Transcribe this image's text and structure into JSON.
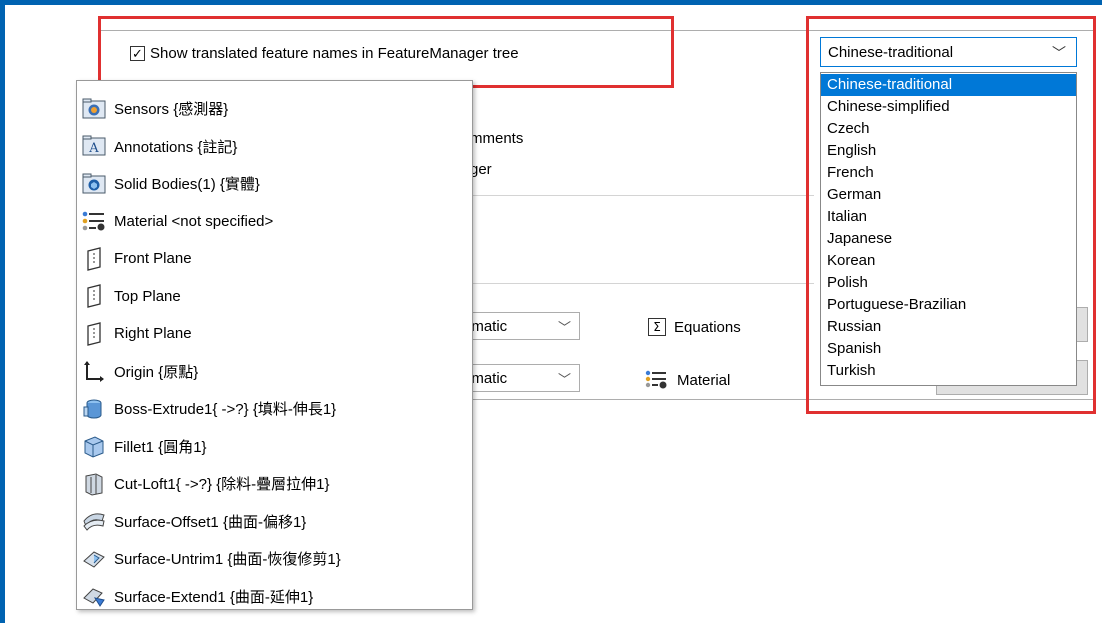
{
  "checkbox": {
    "label": "Show translated feature names in FeatureManager tree",
    "checked": true
  },
  "background": {
    "partial_text_1": "mments",
    "partial_text_2": "ger",
    "combo1_value": "omatic",
    "combo2_value": "omatic",
    "equations_label": "Equations",
    "material_label": "Material"
  },
  "language_dropdown": {
    "selected": "Chinese-traditional",
    "options": [
      "Chinese-traditional",
      "Chinese-simplified",
      "Czech",
      "English",
      "French",
      "German",
      "Italian",
      "Japanese",
      "Korean",
      "Polish",
      "Portuguese-Brazilian",
      "Russian",
      "Spanish",
      "Turkish"
    ]
  },
  "tree": {
    "items": [
      {
        "label": "Sensors {感測器}",
        "icon": "sensors-folder-icon"
      },
      {
        "label": "Annotations {註記}",
        "icon": "annotations-folder-icon"
      },
      {
        "label": "Solid Bodies(1) {實體}",
        "icon": "solid-bodies-folder-icon"
      },
      {
        "label": "Material <not specified>",
        "icon": "material-icon"
      },
      {
        "label": "Front Plane",
        "icon": "plane-icon"
      },
      {
        "label": "Top Plane",
        "icon": "plane-icon"
      },
      {
        "label": "Right Plane",
        "icon": "plane-icon"
      },
      {
        "label": "Origin {原點}",
        "icon": "origin-icon"
      },
      {
        "label": "Boss-Extrude1{ ->?} {填料-伸長1}",
        "icon": "boss-extrude-icon"
      },
      {
        "label": "Fillet1 {圓角1}",
        "icon": "fillet-icon"
      },
      {
        "label": "Cut-Loft1{ ->?} {除料-疊層拉伸1}",
        "icon": "cut-loft-icon"
      },
      {
        "label": "Surface-Offset1 {曲面-偏移1}",
        "icon": "surface-offset-icon"
      },
      {
        "label": "Surface-Untrim1 {曲面-恢復修剪1}",
        "icon": "surface-untrim-icon"
      },
      {
        "label": "Surface-Extend1 {曲面-延伸1}",
        "icon": "surface-extend-icon"
      }
    ]
  },
  "colors": {
    "highlight": "#e03030",
    "selection": "#0078d7",
    "window_border": "#0063b1"
  }
}
